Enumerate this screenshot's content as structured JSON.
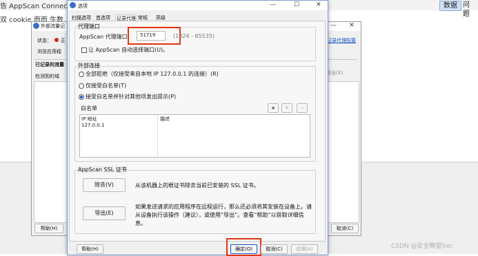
{
  "background_app": {
    "title": "告  AppScan Connect",
    "cookie_bar": "双  cookie  而而  牛数",
    "top_buttons": [
      "数据",
      "问题"
    ]
  },
  "outer_window": {
    "title": "外部流量记",
    "status_label": "状态：",
    "status_value": "正",
    "browse_label": "浏览应用程",
    "recorded_label": "已记录的流量",
    "detected_label": "检测到的域",
    "right_link": "记录代理配置",
    "export_label": "导出(X)",
    "help_button": "帮助(H)",
    "cancel_button": "取消(C)"
  },
  "dialog": {
    "title": "选项",
    "tabs": [
      "扫描选项",
      "首选项",
      "记录代理",
      "常规",
      "高级"
    ],
    "proxy_port": {
      "group_label": "代理端口",
      "label": "AppScan 代理端口",
      "value": "51719",
      "range": "(1024 - 65535)",
      "auto_checkbox": "让 AppScan 自动选择端口(U)。"
    },
    "external_connections": {
      "group_label": "外部连接",
      "options": [
        "全部拒绝（仅接受来自本地 IP 127.0.0.1 的连接）(R)",
        "仅接受白名单(T)",
        "接受白名单并针对其他项发出提示(P)"
      ],
      "whitelist_label": "白名单",
      "whitelist_buttons": [
        "+",
        "✎",
        "−"
      ],
      "columns": [
        "IP 地址",
        "描述"
      ],
      "rows": [
        {
          "ip": "127.0.0.1",
          "desc": ""
        }
      ]
    },
    "ssl": {
      "group_label": "AppScan SSL 证书",
      "remove_button": "除去(V)",
      "remove_desc": "从该机器上的根证书除去当前已安装的 SSL 证书。",
      "export_button": "导出(E)",
      "export_desc": "如果发送请求的应用程序在远程运行，那么还必须将其安装在设备上。请从设备执行该操作（建议），或使用“导出”。查看“帮助”以获取详细信息。"
    },
    "footer": {
      "help": "帮助(H)",
      "ok": "确定(O)",
      "cancel": "取消(C)",
      "apply": "应用(A)"
    }
  },
  "watermark": "CSDN @安全瞭望Sec",
  "colors": {
    "highlight": "#e03515",
    "accent": "#1a56c9"
  }
}
